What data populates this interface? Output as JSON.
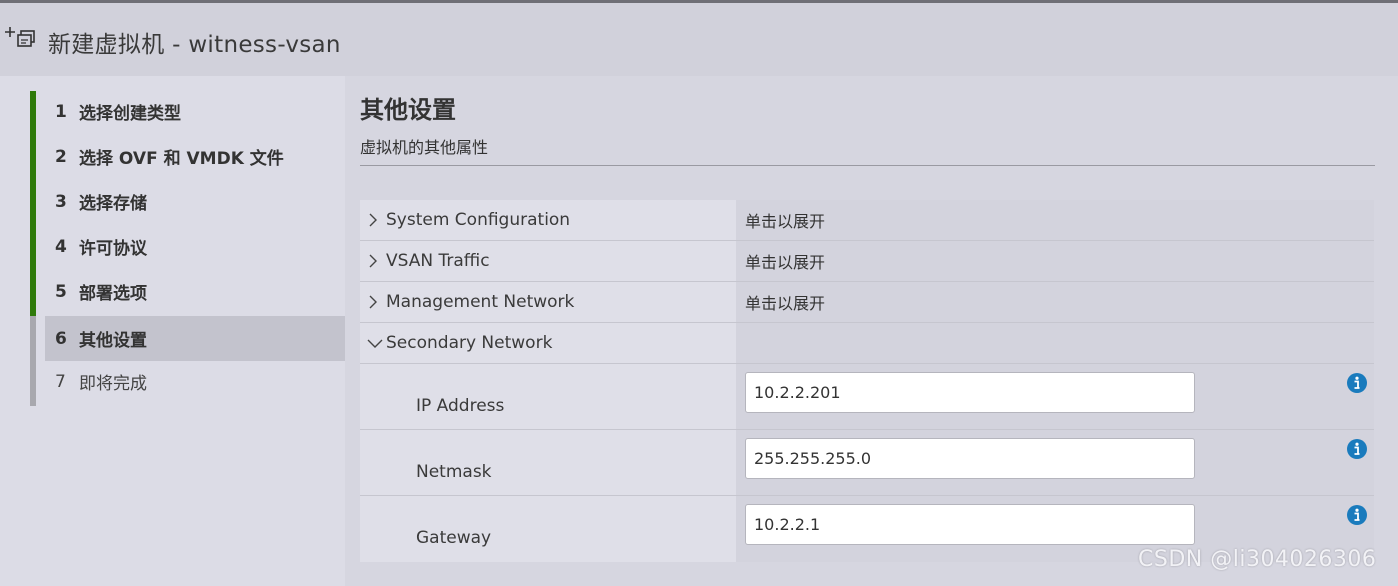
{
  "window": {
    "title": "新建虚拟机 - witness-vsan",
    "icon": "new-vm-icon"
  },
  "wizard": {
    "steps": [
      {
        "num": "1",
        "label": "选择创建类型",
        "state": "done"
      },
      {
        "num": "2",
        "label": "选择 OVF 和 VMDK 文件",
        "state": "done"
      },
      {
        "num": "3",
        "label": "选择存储",
        "state": "done"
      },
      {
        "num": "4",
        "label": "许可协议",
        "state": "done"
      },
      {
        "num": "5",
        "label": "部署选项",
        "state": "done"
      },
      {
        "num": "6",
        "label": "其他设置",
        "state": "active"
      },
      {
        "num": "7",
        "label": "即将完成",
        "state": "pending"
      }
    ],
    "done_color": "#2f7a0a",
    "pending_color": "#a8a8ae"
  },
  "main": {
    "title": "其他设置",
    "subtitle": "虚拟机的其他属性",
    "groups": [
      {
        "label": "System Configuration",
        "value": "单击以展开",
        "expanded": false
      },
      {
        "label": "VSAN Traffic",
        "value": "单击以展开",
        "expanded": false
      },
      {
        "label": "Management Network",
        "value": "单击以展开",
        "expanded": false
      },
      {
        "label": "Secondary Network",
        "value": "",
        "expanded": true
      }
    ],
    "fields": [
      {
        "label": "IP Address",
        "value": "10.2.2.201"
      },
      {
        "label": "Netmask",
        "value": "255.255.255.0"
      },
      {
        "label": "Gateway",
        "value": "10.2.2.1"
      }
    ],
    "info_color": "#1a7bbd"
  },
  "watermark": "CSDN @li304026306"
}
